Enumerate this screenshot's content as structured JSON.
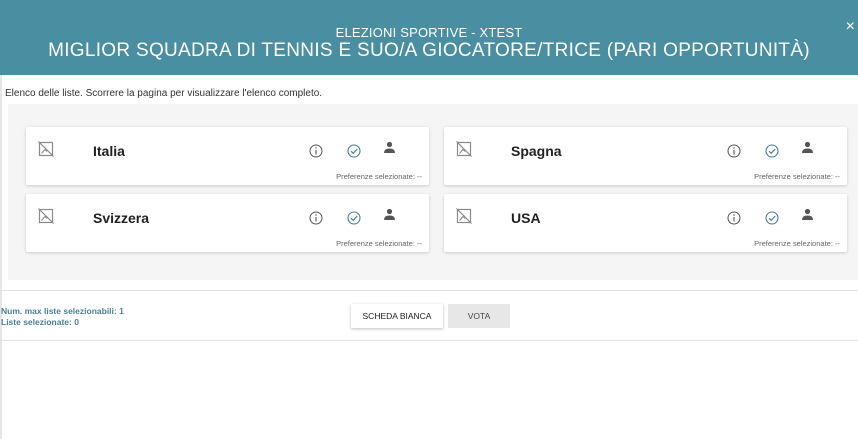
{
  "header": {
    "subtitle": "ELEZIONI SPORTIVE - XTEST",
    "title": "MIGLIOR SQUADRA DI TENNIS E SUO/A GIOCATORE/TRICE (PARI OPPORTUNITÀ)",
    "close_symbol": "×"
  },
  "instructions": "Elenco delle liste. Scorrere la pagina per visualizzare l'elenco completo.",
  "lists": [
    {
      "name": "Italia",
      "preferences": "Preferenze selezionate: --"
    },
    {
      "name": "Spagna",
      "preferences": "Preferenze selezionate: --"
    },
    {
      "name": "Svizzera",
      "preferences": "Preferenze selezionate: --"
    },
    {
      "name": "USA",
      "preferences": "Preferenze selezionate: --"
    }
  ],
  "footer": {
    "max_lists": "Num. max liste selezionabili: 1",
    "selected_lists": "Liste selezionate: 0",
    "blank_ballot_label": "SCHEDA BIANCA",
    "vote_label": "VOTA"
  },
  "icons": {
    "placeholder": "no-image-icon",
    "info": "info-icon",
    "check": "check-circle-icon",
    "person": "person-icon"
  },
  "colors": {
    "header_bg": "#4a8ea1",
    "accent": "#4a7f93",
    "panel_bg": "#f5f5f5"
  }
}
